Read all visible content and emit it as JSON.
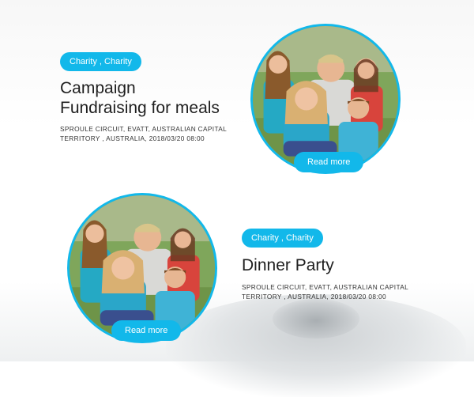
{
  "events": [
    {
      "tag": "Charity , Charity",
      "title": "Campaign Fundraising for meals",
      "meta": "SPROULE CIRCUIT, EVATT, AUSTRALIAN CAPITAL TERRITORY , AUSTRALIA, 2018/03/20 08:00",
      "button": "Read more"
    },
    {
      "tag": "Charity , Charity",
      "title": "Dinner Party",
      "meta": "SPROULE CIRCUIT, EVATT, AUSTRALIAN CAPITAL TERRITORY , AUSTRALIA, 2018/03/20 08:00",
      "button": "Read more"
    }
  ],
  "colors": {
    "accent": "#12b8ea",
    "title": "#1f1f1f",
    "text": "#333333"
  },
  "images": [
    "family-photo",
    "family-photo"
  ]
}
